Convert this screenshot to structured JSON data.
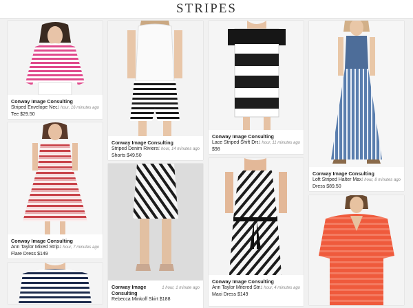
{
  "header": {
    "title": "STRIPES"
  },
  "pins": [
    {
      "author": "Conway Image Consulting",
      "desc1": "Striped Envelope Neck",
      "time": "1 hour, 16 minutes ago",
      "desc2": "Tee $29.50"
    },
    {
      "author": "Conway Image Consulting",
      "desc1": "Ann Taylor Mixed Stripe",
      "time": "1 hour, 7 minutes ago",
      "desc2": "Flare Dress $149"
    },
    {
      "author": "Conway Image Consulting",
      "desc1": "Striped Denim Riviera",
      "time": "1 hour, 14 minutes ago",
      "desc2": "Shorts $49.50"
    },
    {
      "author": "Conway Image Consulting",
      "desc1": "Rebecca Minkoff Skirt $188",
      "time": "1 hour, 1 minute ago",
      "desc2": ""
    },
    {
      "author": "Conway Image Consulting",
      "desc1": "Lace Striped Shift Dress",
      "time": "1 hour, 11 minutes ago",
      "desc2": "$98"
    },
    {
      "author": "Conway Image Consulting",
      "desc1": "Ann Taylor Mitered Stripe",
      "time": "1 hour, 4 minutes ago",
      "desc2": "Maxi Dress $149"
    },
    {
      "author": "Conway Image Consulting",
      "desc1": "Loft Striped Halter Maxi",
      "time": "1 hour, 8 minutes ago",
      "desc2": "Dress $89.50"
    }
  ]
}
